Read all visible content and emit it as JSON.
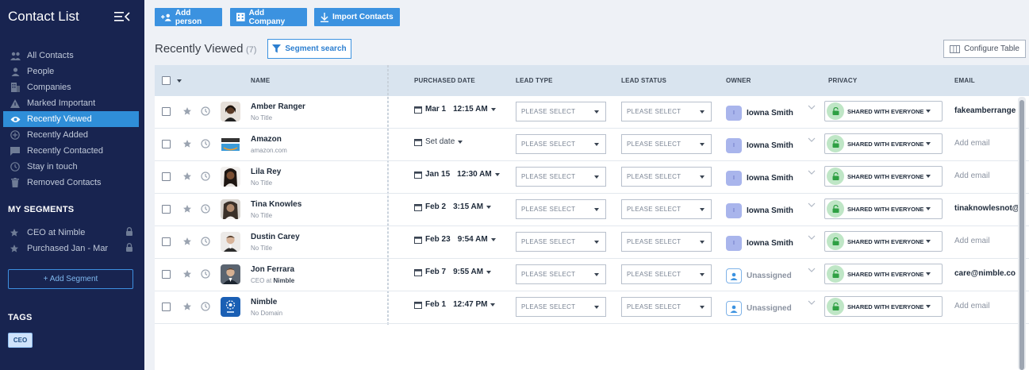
{
  "sidebar": {
    "title": "Contact List",
    "nav": [
      {
        "label": "All Contacts",
        "icon": "group-icon"
      },
      {
        "label": "People",
        "icon": "person-icon"
      },
      {
        "label": "Companies",
        "icon": "building-icon"
      },
      {
        "label": "Marked Important",
        "icon": "warning-icon"
      },
      {
        "label": "Recently Viewed",
        "icon": "eye-icon",
        "active": true
      },
      {
        "label": "Recently Added",
        "icon": "plus-circle-icon"
      },
      {
        "label": "Recently Contacted",
        "icon": "chat-icon"
      },
      {
        "label": "Stay in touch",
        "icon": "clock-icon"
      },
      {
        "label": "Removed Contacts",
        "icon": "trash-icon"
      }
    ],
    "segments_heading": "MY SEGMENTS",
    "segments": [
      {
        "label": "CEO at Nimble"
      },
      {
        "label": "Purchased Jan - Mar"
      }
    ],
    "add_segment": "+ Add Segment",
    "tags_heading": "TAGS",
    "tags": [
      "CEO"
    ]
  },
  "toolbar": {
    "add_person": "Add person",
    "add_company": "Add Company",
    "import_contacts": "Import Contacts"
  },
  "view": {
    "title": "Recently Viewed",
    "count": "(7)",
    "segment_search": "Segment search",
    "configure_table": "Configure Table"
  },
  "columns": {
    "name": "NAME",
    "purchased_date": "PURCHASED DATE",
    "lead_type": "LEAD TYPE",
    "lead_status": "LEAD STATUS",
    "owner": "OWNER",
    "privacy": "PRIVACY",
    "email": "EMAIL"
  },
  "rows": [
    {
      "name": "Amber Ranger",
      "sub": "No Title",
      "date": "Mar 1",
      "time": "12:15 AM",
      "lead_type": "PLEASE SELECT",
      "lead_status": "PLEASE SELECT",
      "owner": "Iowna Smith",
      "owner_initial": "I",
      "privacy": "SHARED WITH EVERYONE",
      "email": "fakeamberrange"
    },
    {
      "name": "Amazon",
      "sub": "amazon.com",
      "date": "Set date",
      "time": "",
      "lead_type": "PLEASE SELECT",
      "lead_status": "PLEASE SELECT",
      "owner": "Iowna Smith",
      "owner_initial": "I",
      "privacy": "SHARED WITH EVERYONE",
      "email": "Add email"
    },
    {
      "name": "Lila Rey",
      "sub": "No Title",
      "date": "Jan 15",
      "time": "12:30 AM",
      "lead_type": "PLEASE SELECT",
      "lead_status": "PLEASE SELECT",
      "owner": "Iowna Smith",
      "owner_initial": "I",
      "privacy": "SHARED WITH EVERYONE",
      "email": "Add email"
    },
    {
      "name": "Tina Knowles",
      "sub": "No Title",
      "date": "Feb 2",
      "time": "3:15 AM",
      "lead_type": "PLEASE SELECT",
      "lead_status": "PLEASE SELECT",
      "owner": "Iowna Smith",
      "owner_initial": "I",
      "privacy": "SHARED WITH EVERYONE",
      "email": "tinaknowlesnot@"
    },
    {
      "name": "Dustin Carey",
      "sub": "No Title",
      "date": "Feb 23",
      "time": "9:54 AM",
      "lead_type": "PLEASE SELECT",
      "lead_status": "PLEASE SELECT",
      "owner": "Iowna Smith",
      "owner_initial": "I",
      "privacy": "SHARED WITH EVERYONE",
      "email": "Add email"
    },
    {
      "name": "Jon Ferrara",
      "sub_prefix": "CEO at",
      "sub_company": "Nimble",
      "date": "Feb 7",
      "time": "9:55 AM",
      "lead_type": "PLEASE SELECT",
      "lead_status": "PLEASE SELECT",
      "owner": "Unassigned",
      "privacy": "SHARED WITH EVERYONE",
      "email": "care@nimble.co"
    },
    {
      "name": "Nimble",
      "sub": "No Domain",
      "date": "Feb 1",
      "time": "12:47 PM",
      "lead_type": "PLEASE SELECT",
      "lead_status": "PLEASE SELECT",
      "owner": "Unassigned",
      "privacy": "SHARED WITH EVERYONE",
      "email": "Add email"
    }
  ]
}
